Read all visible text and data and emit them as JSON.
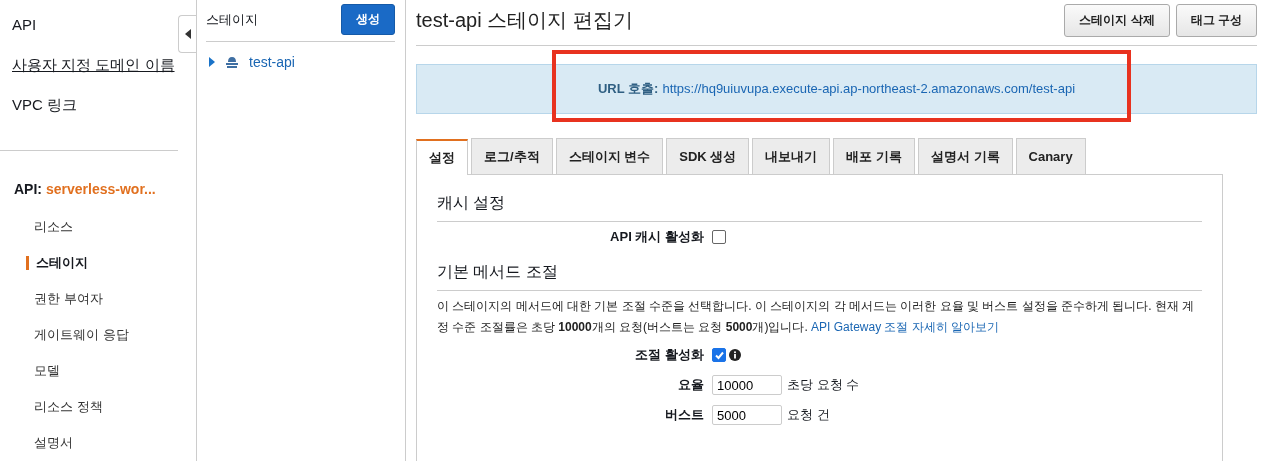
{
  "nav": {
    "top_items": [
      {
        "label": "API",
        "underlined": false
      },
      {
        "label": "사용자 지정 도메인 이름",
        "underlined": true
      },
      {
        "label": "VPC 링크",
        "underlined": false
      }
    ],
    "api_label": "API:",
    "api_name": "serverless-wor...",
    "items": [
      {
        "label": "리소스",
        "selected": false
      },
      {
        "label": "스테이지",
        "selected": true
      },
      {
        "label": "권한 부여자",
        "selected": false
      },
      {
        "label": "게이트웨이 응답",
        "selected": false
      },
      {
        "label": "모델",
        "selected": false
      },
      {
        "label": "리소스 정책",
        "selected": false
      },
      {
        "label": "설명서",
        "selected": false
      }
    ]
  },
  "stages": {
    "title": "스테이지",
    "create_button": "생성",
    "tree": [
      {
        "label": "test-api",
        "expanded": false
      }
    ]
  },
  "editor": {
    "title": "test-api 스테이지 편집기",
    "buttons": [
      "스테이지 삭제",
      "태그 구성"
    ],
    "invoke_url": {
      "label": "URL 호출:",
      "url": "https://hq9uiuvupa.execute-api.ap-northeast-2.amazonaws.com/test-api",
      "highlighted": true
    },
    "tabs": [
      {
        "label": "설정",
        "selected": true
      },
      {
        "label": "로그/추적",
        "selected": false
      },
      {
        "label": "스테이지 변수",
        "selected": false
      },
      {
        "label": "SDK 생성",
        "selected": false
      },
      {
        "label": "내보내기",
        "selected": false
      },
      {
        "label": "배포 기록",
        "selected": false
      },
      {
        "label": "설명서 기록",
        "selected": false
      },
      {
        "label": "Canary",
        "selected": false
      }
    ],
    "sections": [
      {
        "heading": "캐시 설정",
        "fields": [
          {
            "kind": "checkbox",
            "label": "API 캐시 활성화",
            "checked": false
          }
        ]
      },
      {
        "heading": "기본 메서드 조절",
        "description": "이 스테이지의 메서드에 대한 기본 조절 수준을 선택합니다. 이 스테이지의 각 메서드는 이러한 요율 및 버스트 설정을 준수하게 됩니다. 현재 계정 수준 조절률은 초당 **10000**개의 요청(버스트는 요청 **5000**개)입니다.",
        "link": "API Gateway 조절 자세히 알아보기",
        "fields": [
          {
            "kind": "checkbox",
            "label": "조절 활성화",
            "checked": true,
            "info": true
          },
          {
            "kind": "input",
            "label": "요율",
            "value": "10000",
            "unit": "초당 요청 수"
          },
          {
            "kind": "input",
            "label": "버스트",
            "value": "5000",
            "unit": "요청 건"
          }
        ]
      }
    ]
  }
}
